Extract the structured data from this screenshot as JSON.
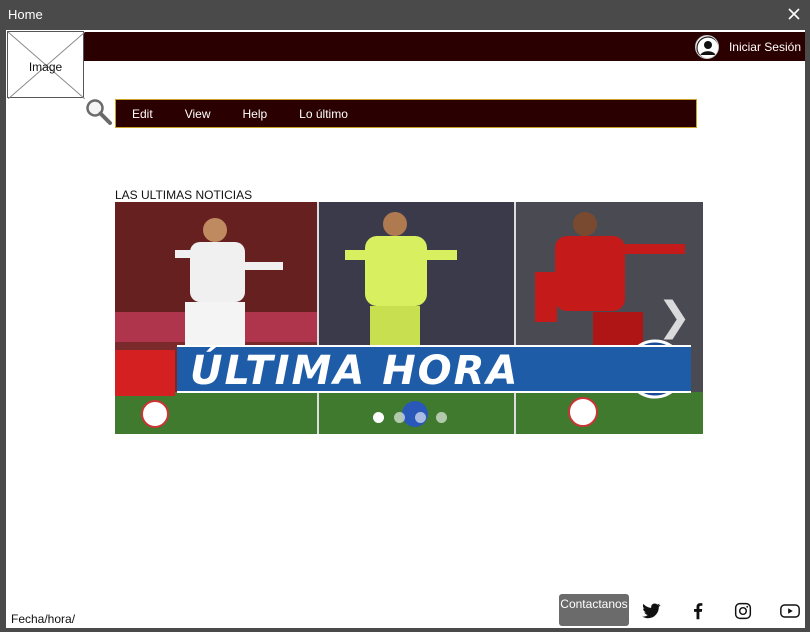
{
  "window": {
    "title": "Home"
  },
  "logo": {
    "label": "Image"
  },
  "header": {
    "login_label": "Iniciar Sesión"
  },
  "menu": {
    "items": [
      {
        "label": "Edit"
      },
      {
        "label": "View"
      },
      {
        "label": "Help"
      },
      {
        "label": "Lo último"
      }
    ]
  },
  "news": {
    "section_title": "LAS ULTIMAS NOTICIAS",
    "banner_text": "ÚLTIMA HORA",
    "slide_count": 4,
    "active_slide": 1
  },
  "footer": {
    "datetime_label": "Fecha/hora/",
    "contact_label": "Contactanos",
    "social_icons": [
      "twitter-icon",
      "facebook-icon",
      "instagram-icon",
      "youtube-icon"
    ]
  },
  "colors": {
    "bar_dark": "#2a0000",
    "menu_border": "#c9a227",
    "titlebar": "#4a4a4a",
    "banner_blue": "#1f5ca8"
  }
}
